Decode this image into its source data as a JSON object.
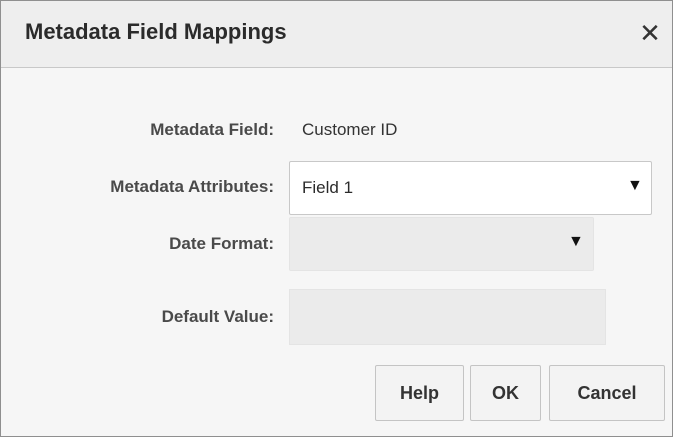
{
  "dialog": {
    "title": "Metadata Field Mappings",
    "close_glyph": "✕",
    "close_icon": "close-icon"
  },
  "form": {
    "metadata_field": {
      "label": "Metadata Field:",
      "value": "Customer ID"
    },
    "metadata_attributes": {
      "label": "Metadata Attributes:",
      "selected": "Field 1",
      "arrow": "▼"
    },
    "date_format": {
      "label": "Date Format:",
      "selected": "",
      "arrow": "▼"
    },
    "default_value": {
      "label": "Default Value:",
      "value": ""
    }
  },
  "buttons": {
    "help": "Help",
    "ok": "OK",
    "cancel": "Cancel"
  }
}
